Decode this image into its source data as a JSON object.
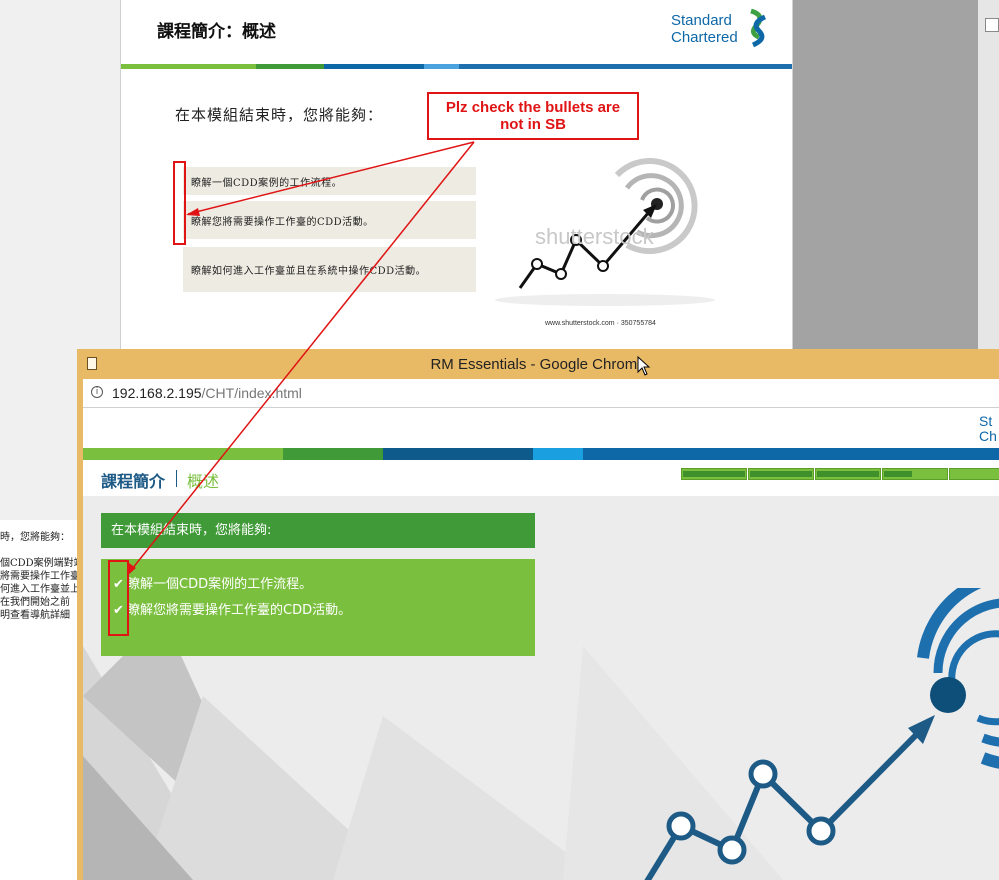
{
  "background_doc": {
    "lines": [
      "時，您將能夠：",
      "個CDD案例端對端",
      "將需要操作工作臺",
      "何進入工作臺並上",
      "在我們開始之前",
      "明查看導航詳細"
    ]
  },
  "storyboard": {
    "title": "課程簡介：概述",
    "logo_line1": "Standard",
    "logo_line2": "Chartered",
    "lead": "在本模組結束時，您將能夠：",
    "bullets": [
      "瞭解一個CDD案例的工作流程。",
      "瞭解您將需要操作工作臺的CDD活動。",
      "瞭解如何進入工作臺並且在系統中操作CDD活動。"
    ],
    "image_watermark": "shutterstock",
    "image_caption": "www.shutterstock.com · 350755784"
  },
  "annotation": {
    "text_line1": "Plz check the bullets are",
    "text_line2": "not in SB"
  },
  "browser": {
    "window_title": "RM Essentials - Google Chrome",
    "url_host": "192.168.2.195",
    "url_path": "/CHT/index.html",
    "logo_line1": "St",
    "logo_line2": "Ch",
    "nav_title": "課程簡介",
    "nav_subtitle": "概述",
    "heading": "在本模組結束時，您將能夠:",
    "bullets": [
      "瞭解一個CDD案例的工作流程。",
      "瞭解您將需要操作工作臺的CDD活動。"
    ]
  },
  "colors": {
    "brand_blue": "#0e68a8",
    "brand_green": "#7bbf3f",
    "dark_green": "#3f9a37",
    "annotation_red": "#e01414",
    "window_frame": "#e8ba66"
  }
}
